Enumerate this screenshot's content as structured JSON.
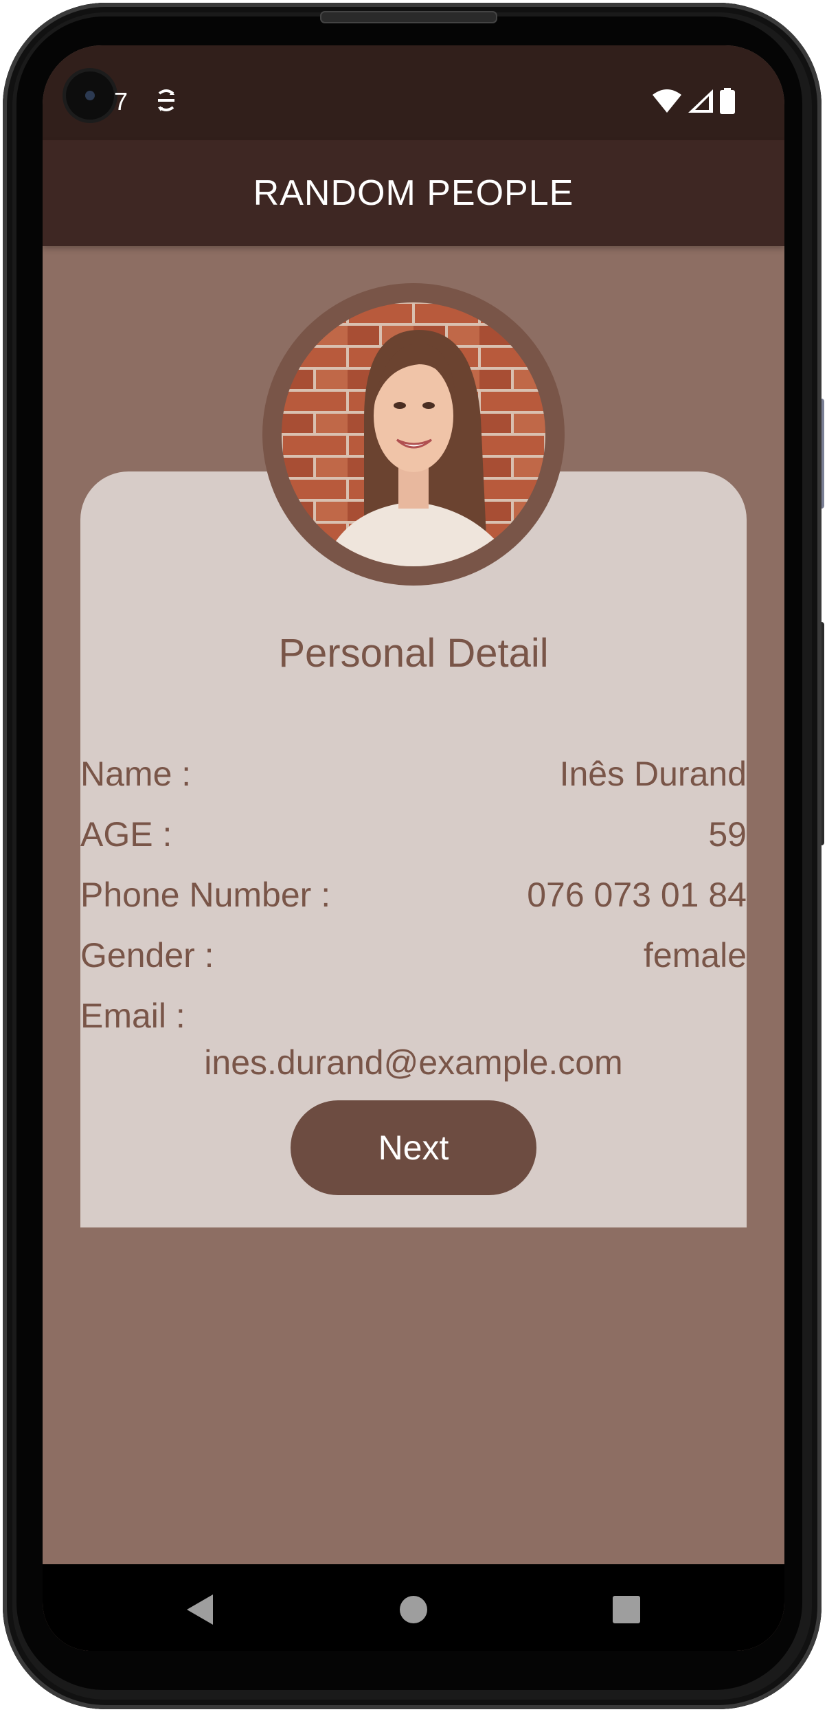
{
  "status_bar": {
    "time": "7",
    "notification_icon": "sync-icon",
    "icons": [
      "wifi-icon",
      "signal-icon",
      "battery-icon"
    ]
  },
  "app_bar": {
    "title": "RANDOM PEOPLE"
  },
  "profile": {
    "avatar_icon": "profile-photo",
    "section_title": "Personal Detail",
    "fields": [
      {
        "label": "Name :",
        "value": "Inês Durand"
      },
      {
        "label": "AGE :",
        "value": "59"
      },
      {
        "label": "Phone Number :",
        "value": "076 073 01 84"
      },
      {
        "label": "Gender :",
        "value": "female"
      }
    ],
    "email_label": "Email :",
    "email_value": "ines.durand@example.com"
  },
  "actions": {
    "next_label": "Next"
  },
  "navigation": {
    "buttons": [
      "back-icon",
      "home-icon",
      "recents-icon"
    ]
  },
  "colors": {
    "status_bar": "#311f1b",
    "app_bar": "#3e2723",
    "background": "#8d6e63",
    "card": "#d7ccc8",
    "text": "#795548",
    "button": "#6d4c41",
    "avatar_ring": "#795548"
  }
}
